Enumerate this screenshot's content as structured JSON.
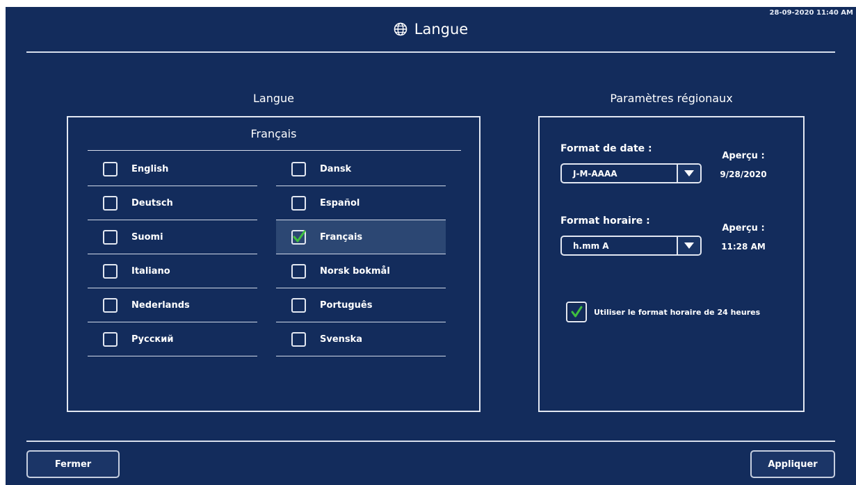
{
  "header": {
    "title": "Langue",
    "title_icon": "globe-icon",
    "datetime": "28-09-2020 11:40 AM"
  },
  "language_panel": {
    "heading": "Langue",
    "current_language": "Français",
    "left_column": [
      {
        "label": "English",
        "checked": false
      },
      {
        "label": "Deutsch",
        "checked": false
      },
      {
        "label": "Suomi",
        "checked": false
      },
      {
        "label": "Italiano",
        "checked": false
      },
      {
        "label": "Nederlands",
        "checked": false
      },
      {
        "label": "Русский",
        "checked": false
      }
    ],
    "right_column": [
      {
        "label": "Dansk",
        "checked": false
      },
      {
        "label": "Español",
        "checked": false
      },
      {
        "label": "Français",
        "checked": true
      },
      {
        "label": "Norsk bokmål",
        "checked": false
      },
      {
        "label": "Português",
        "checked": false
      },
      {
        "label": "Svenska",
        "checked": false
      }
    ]
  },
  "regional_panel": {
    "heading": "Paramètres régionaux",
    "date_format": {
      "label": "Format de date :",
      "value": "J-M-AAAA",
      "preview_label": "Aperçu :",
      "preview_value": "9/28/2020"
    },
    "time_format": {
      "label": "Format horaire :",
      "value": "h.mm A",
      "preview_label": "Aperçu :",
      "preview_value": "11:28 AM"
    },
    "use_24h": {
      "label": "Utiliser le format horaire de 24 heures",
      "checked": true
    }
  },
  "footer": {
    "close_label": "Fermer",
    "apply_label": "Appliquer"
  },
  "colors": {
    "background": "#132c5c",
    "selected_row": "#2c4773",
    "check_green": "#3fbf3f",
    "border": "#e3e8f2"
  }
}
